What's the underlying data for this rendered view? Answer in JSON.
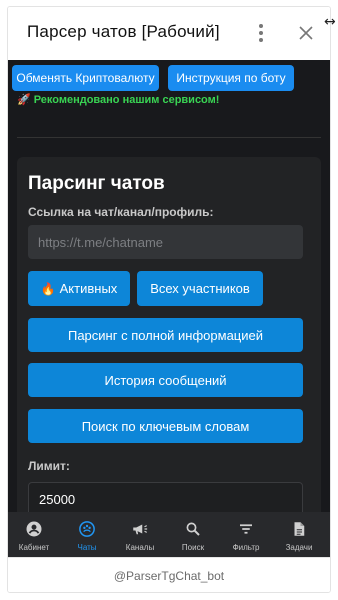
{
  "window": {
    "title": "Парсер чатов [Рабочий]",
    "menu_icon": "more-vert-icon",
    "close_icon": "close-icon"
  },
  "top_actions": {
    "exchange_label": "Обменять Криптовалюту",
    "guide_label": "Инструкция по боту"
  },
  "promo": {
    "icon": "rocket-icon",
    "text": "Рекомендовано нашим сервисом!"
  },
  "parser_card": {
    "title": "Парсинг чатов",
    "link_label": "Ссылка на чат/канал/профиль:",
    "link_placeholder": "https://t.me/chatname",
    "active_icon": "fire-icon",
    "active_label": "Активных",
    "all_members_label": "Всех участников",
    "full_info_label": "Парсинг с полной информацией",
    "history_label": "История сообщений",
    "keywords_label": "Поиск по ключевым словам",
    "limit_label": "Лимит:",
    "limit_value": "25000"
  },
  "bottom_nav": {
    "items": [
      {
        "label": "Кабинет",
        "icon": "account-icon"
      },
      {
        "label": "Чаты",
        "icon": "chats-icon",
        "active": true
      },
      {
        "label": "Каналы",
        "icon": "megaphone-icon"
      },
      {
        "label": "Поиск",
        "icon": "search-icon"
      },
      {
        "label": "Фильтр",
        "icon": "filter-icon"
      },
      {
        "label": "Задачи",
        "icon": "document-icon"
      }
    ]
  },
  "footer": {
    "bot_name": "@ParserTgChat_bot"
  },
  "colors": {
    "accent": "#1a8cf0",
    "button": "#0d86d8",
    "promo_green": "#39d353",
    "app_background": "#18191c",
    "card_background": "#222325",
    "nav_active": "#2196f3"
  }
}
